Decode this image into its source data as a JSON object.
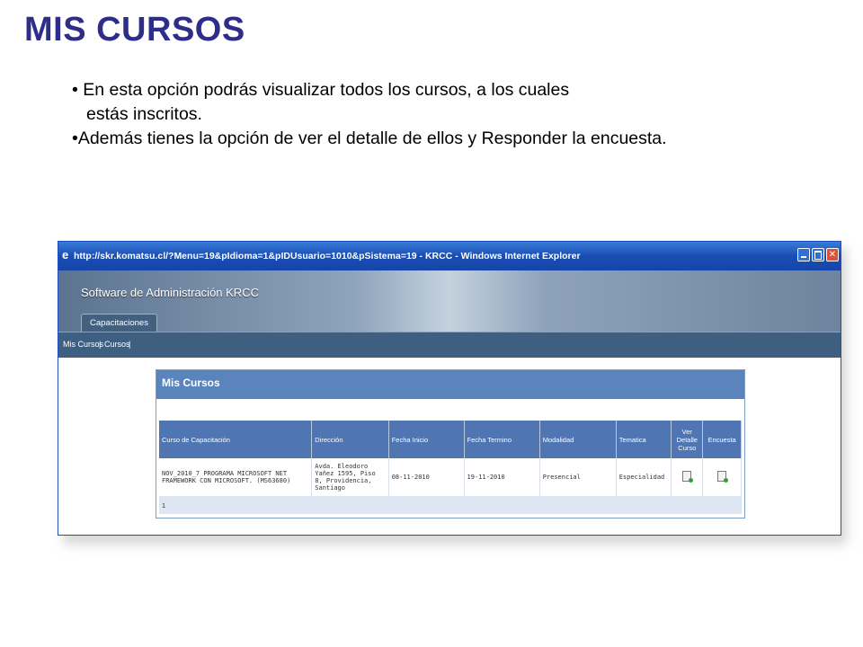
{
  "slide": {
    "title": "MIS CURSOS",
    "bullet1_line1": "• En esta opción podrás visualizar todos los cursos, a los cuales",
    "bullet1_line2": "estás inscritos.",
    "bullet2": "•Además tienes la opción de ver el detalle de ellos y Responder la encuesta."
  },
  "browser": {
    "title": "http://skr.komatsu.cl/?Menu=19&pIdioma=1&pIDUsuario=1010&pSistema=19 - KRCC - Windows Internet Explorer",
    "icon": "ie-icon",
    "buttons": [
      "minimize",
      "maximize",
      "close"
    ]
  },
  "app": {
    "title": "Software de Administración KRCC",
    "tab": "Capacitaciones",
    "subnav": {
      "item1": "Mis Cursos",
      "sep": "|",
      "item2": "Cursos",
      "sep2": "|"
    }
  },
  "panel": {
    "title": "Mis Cursos",
    "columns": [
      "Curso de Capacitación",
      "Dirección",
      "Fecha Inicio",
      "Fecha Termino",
      "Modalidad",
      "Tematica",
      "Ver Detalle Curso",
      "Encuesta"
    ],
    "rows": [
      {
        "curso": "NOV_2010_7 PROGRAMA MICROSOFT NET FRAMEWORK CON MICROSOFT. (MS63680)",
        "direccion": "Avda. Eleodoro Yañez 1595, Piso 8, Providencia, Santiago",
        "fecha_inicio": "08-11-2010",
        "fecha_termino": "19-11-2010",
        "modalidad": "Presencial",
        "tematica": "Especialidad",
        "ver_detalle_icon": "document-view-icon",
        "encuesta_icon": "survey-icon"
      }
    ],
    "pager": "1"
  }
}
